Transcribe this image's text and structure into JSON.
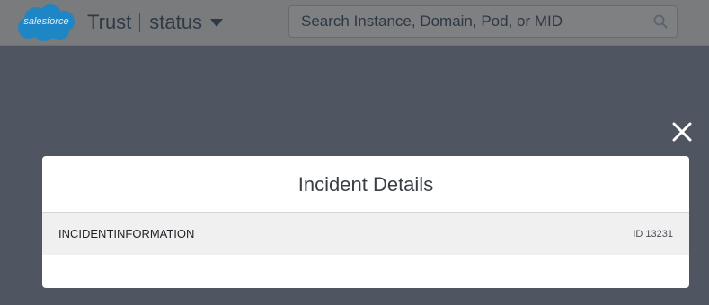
{
  "header": {
    "logo_text": "salesforce",
    "brand_trust": "Trust",
    "brand_status": "status",
    "search_placeholder": "Search Instance, Domain, Pod, or MID"
  },
  "modal": {
    "title": "Incident Details",
    "info_label": "INCIDENTINFORMATION",
    "incident_id": "ID 13231"
  },
  "icons": {
    "logo": "salesforce-cloud-logo",
    "caret": "caret-down-icon",
    "search": "search-icon",
    "close": "close-icon"
  },
  "colors": {
    "overlay": "#4f5661",
    "header_dimmed": "#7a7b7c",
    "logo_cloud": "#1f86c5",
    "modal_bg": "#ffffff",
    "row_bg": "#f0f0f0",
    "close_icon": "#ffffff"
  }
}
